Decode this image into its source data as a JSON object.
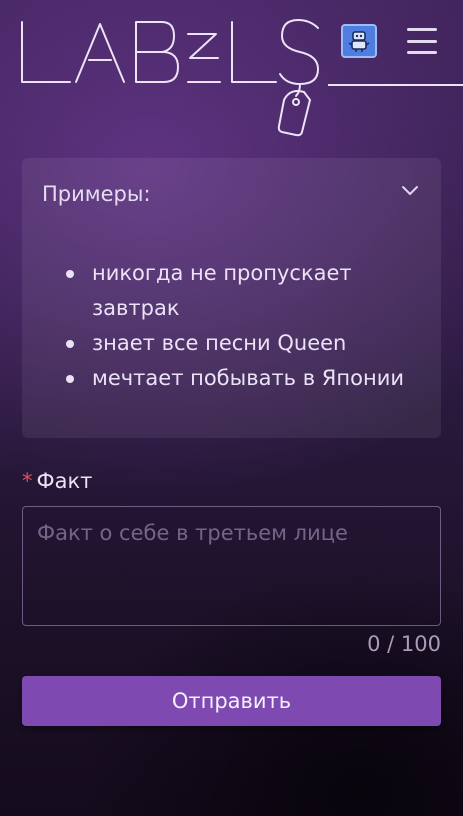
{
  "header": {
    "logo_text": "LABELS",
    "bot_button_icon": "robot-icon",
    "menu_button_icon": "hamburger-menu-icon"
  },
  "examples": {
    "title": "Примеры:",
    "toggle_icon": "chevron-down-icon",
    "items": [
      "никогда не пропускает завтрак",
      "знает все песни Queen",
      "мечтает побывать в Японии"
    ]
  },
  "fact_field": {
    "required_mark": "*",
    "label": "Факт",
    "value": "",
    "placeholder": "Факт о себе в третьем лице",
    "counter": "0 / 100"
  },
  "submit": {
    "label": "Отправить"
  },
  "colors": {
    "accent": "#7e4ab2",
    "required": "#e0505f",
    "bot_button": "#4f7ee0"
  }
}
